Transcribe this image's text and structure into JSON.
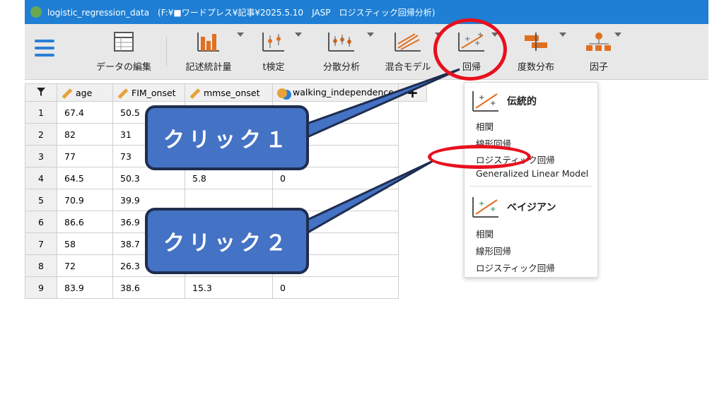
{
  "window": {
    "title": "logistic_regression_data　(F:¥■ワードプレス¥記事¥2025.5.10　JASP　ロジスティック回帰分析)"
  },
  "toolbar": {
    "buttons": [
      {
        "label": "データの編集",
        "icon": "table-icon"
      },
      {
        "label": "記述統計量",
        "icon": "bar-chart-icon"
      },
      {
        "label": "t検定",
        "icon": "t-test-icon"
      },
      {
        "label": "分散分析",
        "icon": "anova-icon"
      },
      {
        "label": "混合モデル",
        "icon": "mixed-model-icon"
      },
      {
        "label": "回帰",
        "icon": "regression-icon"
      },
      {
        "label": "度数分布",
        "icon": "frequencies-icon"
      },
      {
        "label": "因子",
        "icon": "factor-icon"
      }
    ]
  },
  "grid": {
    "columns": [
      "age",
      "FIM_onset",
      "mmse_onset",
      "walking_independence"
    ],
    "rows": [
      [
        "1",
        "67.4",
        "50.5",
        "",
        ""
      ],
      [
        "2",
        "82",
        "31",
        "",
        ""
      ],
      [
        "3",
        "77",
        "73",
        "",
        ""
      ],
      [
        "4",
        "64.5",
        "50.3",
        "5.8",
        "0"
      ],
      [
        "5",
        "70.9",
        "39.9",
        "",
        ""
      ],
      [
        "6",
        "86.6",
        "36.9",
        "",
        ""
      ],
      [
        "7",
        "58",
        "38.7",
        "",
        ""
      ],
      [
        "8",
        "72",
        "26.3",
        "",
        ""
      ],
      [
        "9",
        "83.9",
        "38.6",
        "15.3",
        "0"
      ]
    ]
  },
  "menu": {
    "classical": {
      "header": "伝統的",
      "items": [
        "相関",
        "線形回帰",
        "ロジスティック回帰",
        "Generalized Linear Model"
      ]
    },
    "bayesian": {
      "header": "ベイジアン",
      "items": [
        "相関",
        "線形回帰",
        "ロジスティック回帰"
      ]
    }
  },
  "annotations": {
    "callout1": "クリック１",
    "callout2": "クリック２"
  },
  "colors": {
    "accent": "#1e7fd4",
    "callout": "#4472c4",
    "highlight": "#e8101e",
    "icon_orange": "#e07020"
  }
}
